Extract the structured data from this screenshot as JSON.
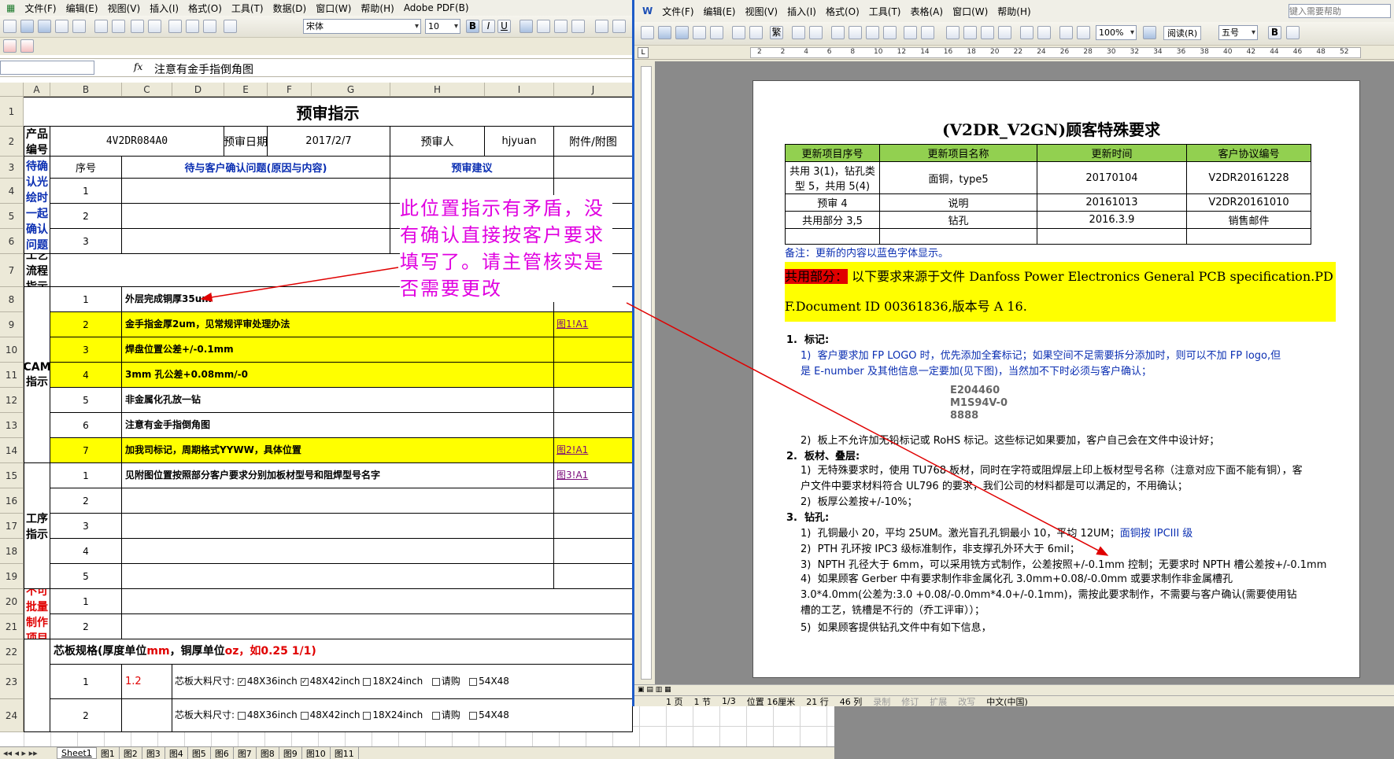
{
  "excel": {
    "menu": [
      "文件(F)",
      "编辑(E)",
      "视图(V)",
      "插入(I)",
      "格式(O)",
      "工具(T)",
      "数据(D)",
      "窗口(W)",
      "帮助(H)",
      "Adobe PDF(B)"
    ],
    "font_name": "宋体",
    "font_size": "10",
    "formula_label": "fx",
    "formula_value": "注意有金手指倒角图",
    "columns": [
      "A",
      "B",
      "C",
      "D",
      "E",
      "F",
      "G",
      "H",
      "I",
      "J"
    ],
    "rows": [
      "1",
      "2",
      "3",
      "4",
      "5",
      "6",
      "7",
      "8",
      "9",
      "10",
      "11",
      "12",
      "13",
      "14",
      "15",
      "16",
      "17",
      "18",
      "19",
      "20",
      "21",
      "22",
      "23",
      "24"
    ],
    "title": "预审指示",
    "product_label": "产品编号",
    "product_value": "4V2DR084A0",
    "date_label": "预审日期",
    "date_value": "2017/2/7",
    "reviewer_label": "预审人",
    "reviewer_value": "hjyuan",
    "attach_label": "附件/附图",
    "seq_label": "序号",
    "pending_header": "待与客户确认问题(原因与内容)",
    "advice_header": "预审建议",
    "pending_section": "待确认光绘时一起确认问题",
    "process_section": "工艺流程指示",
    "cam_section": "CAM指示",
    "step_section": "工序指示",
    "nonbatch_section": "不可批量制作项目",
    "nums": {
      "n1": "1",
      "n2": "2",
      "n3": "3",
      "n4": "4",
      "n5": "5",
      "n6": "6",
      "n7": "7"
    },
    "cam_items": [
      "外层完成铜厚35um",
      "金手指金厚2um，见常规评审处理办法",
      "焊盘位置公差+/-0.1mm",
      "3mm 孔公差+0.08mm/-0",
      "非金属化孔放一钻",
      "注意有金手指倒角图",
      "加我司标记，周期格式YYWW，具体位置"
    ],
    "links": [
      "图1!A1",
      "图2!A1",
      "图3!A1"
    ],
    "step_item1": "见附图位置按照部分客户要求分别加板材型号和阻焊型号名字",
    "core_spec_a": "芯板规格(厚度单位",
    "core_spec_b": "mm",
    "core_spec_c": "，铜厚单位",
    "core_spec_d": "oz",
    "core_spec_e": "，如0.25 1/1)",
    "core_val": "1.2",
    "core_size_label": "芯板大料尺寸:",
    "sizes": [
      "48X36inch",
      "48X42inch",
      "18X24inch",
      "请购",
      "54X48"
    ],
    "sheet_tabs": [
      "Sheet1",
      "图1",
      "图2",
      "图3",
      "图4",
      "图5",
      "图6",
      "图7",
      "图8",
      "图9",
      "图10",
      "图11"
    ],
    "callout": "此位置指示有矛盾，没有确认直接按客户要求填写了。请主管核实是否需要更改"
  },
  "word": {
    "menu": [
      "文件(F)",
      "编辑(E)",
      "视图(V)",
      "插入(I)",
      "格式(O)",
      "工具(T)",
      "表格(A)",
      "窗口(W)",
      "帮助(H)"
    ],
    "help_placeholder": "键入需要帮助",
    "zoom": "100%",
    "read_btn": "阅读(R)",
    "font_size": "五号",
    "bold": "B",
    "ruler": [
      "2",
      "2",
      "4",
      "6",
      "8",
      "10",
      "12",
      "14",
      "16",
      "18",
      "20",
      "22",
      "24",
      "26",
      "28",
      "30",
      "32",
      "34",
      "36",
      "38",
      "40",
      "42",
      "44",
      "46",
      "48",
      "52"
    ],
    "doc_title": "(V2DR_V2GN)顾客特殊要求",
    "table_head": [
      "更新项目序号",
      "更新项目名称",
      "更新时间",
      "客户协议编号"
    ],
    "table_rows": [
      [
        "共用 3(1)，钻孔类型 5，共用 5(4)",
        "面铜，type5",
        "20170104",
        "V2DR20161228"
      ],
      [
        "预审 4",
        "说明",
        "20161013",
        "V2DR20161010"
      ],
      [
        "共用部分 3,5",
        "钻孔",
        "2016.3.9",
        "销售邮件"
      ],
      [
        "",
        "",
        "",
        ""
      ]
    ],
    "note": "备注：更新的内容以蓝色字体显示。",
    "shared_label": "共用部分：",
    "shared_text": "以下要求来源于文件 Danfoss Power Electronics General PCB specification.PDF.Document ID 00361836,版本号 A 16.",
    "s1": "标记:",
    "s1_1": "客户要求加 FP LOGO 时，优先添加全套标记；如果空间不足需要拆分添加时，则可以不加 FP logo,但是 E-number 及其他信息一定要加(见下图)，当然加不下时必须与客户确认；",
    "logo": [
      "E204460",
      "M1S94V-0",
      "8888"
    ],
    "s1_2": "板上不允许加无铅标记或 RoHS 标记。这些标记如果要加，客户自己会在文件中设计好；",
    "s2": "板材、叠层:",
    "s2_1": "无特殊要求时，使用 TU768 板材，同时在字符或阻焊层上印上板材型号名称（注意对应下面不能有铜），客户文件中要求材料符合 UL796 的要求，我们公司的材料都是可以满足的，不用确认；",
    "s2_2": "板厚公差按+/-10%；",
    "s3": "钻孔:",
    "s3_1a": "孔铜最小 20，平均 25UM。激光盲孔孔铜最小 10，平均 12UM；",
    "s3_1b": "面铜按 IPCIII 级",
    "s3_2": "PTH 孔环按 IPC3 级标准制作，非支撑孔外环大于 6mil；",
    "s3_3": "NPTH 孔径大于 6mm，可以采用铣方式制作，公差按照+/-0.1mm 控制；无要求时 NPTH 槽公差按+/-0.1mm",
    "s3_4": "如果顾客 Gerber 中有要求制作非金属化孔 3.0mm+0.08/-0.0mm 或要求制作非金属槽孔 3.0*4.0mm(公差为:3.0 +0.08/-0.0mm*4.0+/-0.1mm)，需按此要求制作，不需要与客户确认(需要使用钻槽的工艺，铣槽是不行的（乔工评审））；",
    "s3_5": "如果顾客提供钻孔文件中有如下信息，",
    "status": [
      "1 页",
      "1 节",
      "1/3",
      "位置 16厘米",
      "21 行",
      "46 列",
      "录制",
      "修订",
      "扩展",
      "改写",
      "中文(中国)"
    ]
  },
  "colors": {
    "highlight": "#ffff00",
    "table_header": "#92d050",
    "accent_blue": "#0b2fb2",
    "arrow": "#e00000",
    "callout_text": "#e000e0"
  }
}
